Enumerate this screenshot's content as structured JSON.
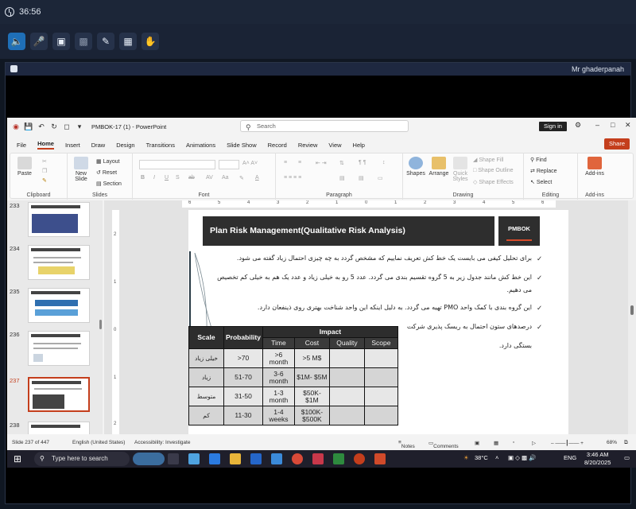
{
  "meeting": {
    "elapsed": "36:56",
    "presenter": "Mr ghaderpanah"
  },
  "ppt": {
    "title": "PMBOK-17 (1)  -  PowerPoint",
    "search_placeholder": "Search",
    "signin": "Sign in",
    "share": "Share",
    "menus": [
      "File",
      "Home",
      "Insert",
      "Draw",
      "Design",
      "Transitions",
      "Animations",
      "Slide Show",
      "Record",
      "Review",
      "View",
      "Help"
    ],
    "ribbon": {
      "clipboard": "Clipboard",
      "paste": "Paste",
      "slides": "Slides",
      "new_slide": "New Slide",
      "layout": "Layout",
      "reset": "Reset",
      "section": "Section",
      "font": "Font",
      "paragraph": "Paragraph",
      "drawing": "Drawing",
      "shapes": "Shapes",
      "arrange": "Arrange",
      "quick_styles": "Quick Styles",
      "shape_fill": "Shape Fill",
      "shape_outline": "Shape Outline",
      "shape_effects": "Shape Effects",
      "find": "Find",
      "replace": "Replace",
      "select": "Select",
      "editing": "Editing",
      "addins": "Add-ins",
      "addins_group": "Add-ins"
    },
    "thumbnails": [
      {
        "num": "233"
      },
      {
        "num": "234"
      },
      {
        "num": "235"
      },
      {
        "num": "236"
      },
      {
        "num": "237"
      },
      {
        "num": "238"
      }
    ],
    "ruler_h": [
      "6",
      "5",
      "4",
      "3",
      "2",
      "1",
      "0",
      "1",
      "2",
      "3",
      "4",
      "5",
      "6"
    ],
    "ruler_v": [
      "2",
      "1",
      "0",
      "1",
      "2"
    ],
    "slide": {
      "title": "Plan Risk Management(Qualitative Risk Analysis)",
      "logo": "PMBOK",
      "bullets": [
        "برای تحلیل کیفی می بایست یک خط کش تعریف نماییم که مشخص گردد به چه چیزی احتمال زیاد گفته می شود.",
        "این خط کش مانند جدول زیر به 5 گروه تقسیم بندی می گردد. عدد 5 رو به خیلی زیاد و عدد یک هم به خیلی کم تخصیص",
        "می دهیم.",
        "این گروه بندی با کمک واحد PMO تهیه می گردد. به دلیل اینکه این واحد شناخت بهتری روی ذینفعان دارد.",
        "درصدهای ستون احتمال به ریسک پذیری شرکت",
        "بستگی دارد."
      ],
      "table": {
        "scale": "Scale",
        "probability": "Probability",
        "impact": "Impact",
        "sub": [
          "Time",
          "Cost",
          "Quality",
          "Scope"
        ],
        "rows": [
          {
            "scale": "خیلی زیاد",
            "prob": ">70",
            "time": ">6 month",
            "cost": ">5 M$"
          },
          {
            "scale": "زیاد",
            "prob": "51-70",
            "time": "3-6 month",
            "cost": "$1M- $5M"
          },
          {
            "scale": "متوسط",
            "prob": "31-50",
            "time": "1-3 month",
            "cost": "$50K- $1M"
          },
          {
            "scale": "کم",
            "prob": "11-30",
            "time": "1-4 weeks",
            "cost": "$100K- $500K"
          }
        ]
      }
    },
    "status": {
      "slide": "Slide 237 of 447",
      "language": "English (United States)",
      "accessibility": "Accessibility: Investigate",
      "notes": "Notes",
      "comments": "Comments",
      "zoom": "68%"
    }
  },
  "taskbar": {
    "search_placeholder": "Type here to search",
    "weather": "38°C",
    "lang": "ENG",
    "time": "3:46 AM",
    "date": "8/20/2025"
  }
}
